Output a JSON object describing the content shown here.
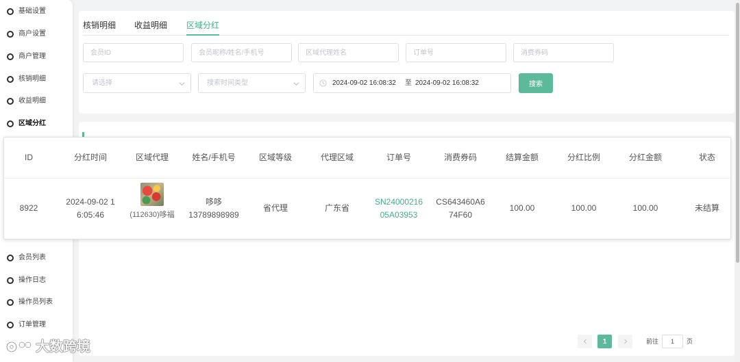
{
  "colors": {
    "accent": "#5cba9b",
    "accent_text": "#3fae8a",
    "link": "#45ad8a",
    "page_bg": "#f2f3f5"
  },
  "sidebar": {
    "items": [
      {
        "label": "基础设置",
        "icon": "circle-icon"
      },
      {
        "label": "商户设置",
        "icon": "circle-icon"
      },
      {
        "label": "商户管理",
        "icon": "circle-icon"
      },
      {
        "label": "核销明细",
        "icon": "circle-icon"
      },
      {
        "label": "收益明细",
        "icon": "circle-icon"
      },
      {
        "label": "区域分红",
        "icon": "circle-icon",
        "active": true
      },
      {
        "label": "会员列表",
        "icon": "circle-icon"
      },
      {
        "label": "操作日志",
        "icon": "circle-icon"
      },
      {
        "label": "操作员列表",
        "icon": "circle-icon"
      },
      {
        "label": "订单管理",
        "icon": "circle-icon"
      }
    ]
  },
  "tabs": [
    {
      "label": "核销明细"
    },
    {
      "label": "收益明细"
    },
    {
      "label": "区域分红",
      "active": true
    }
  ],
  "filters": {
    "member_id_placeholder": "会员ID",
    "member_name_placeholder": "会员昵称/姓名/手机号",
    "agent_name_placeholder": "区域代理姓名",
    "order_no_placeholder": "订单号",
    "coupon_placeholder": "消费券码",
    "select_placeholder": "请选择",
    "time_type_placeholder": "搜索时间类型",
    "start_date": "2024-09-02 16:08:32",
    "range_separator": "至",
    "end_date": "2024-09-02 16:08:32",
    "search_label": "搜索"
  },
  "table": {
    "columns": [
      "ID",
      "分红时间",
      "区域代理",
      "姓名/手机号",
      "区域等级",
      "代理区域",
      "订单号",
      "消费券码",
      "结算金额",
      "分红比例",
      "分红金额",
      "状态"
    ],
    "rows": [
      {
        "id": "8922",
        "time": "2024-09-02 16:05:46",
        "agent": "(112630)哆福",
        "name": "哆哆",
        "phone": "13789898989",
        "level": "省代理",
        "region": "广东省",
        "order_no": "SN2400021605A03953",
        "coupon": "CS643460A674F60",
        "settle_amount": "100.00",
        "ratio": "100.00",
        "dividend": "100.00",
        "status": "未结算"
      }
    ]
  },
  "pagination": {
    "current_page": "1",
    "goto_label": "前往",
    "goto_value": "1",
    "page_unit": "页"
  },
  "watermark": {
    "text": "大数跨境"
  }
}
